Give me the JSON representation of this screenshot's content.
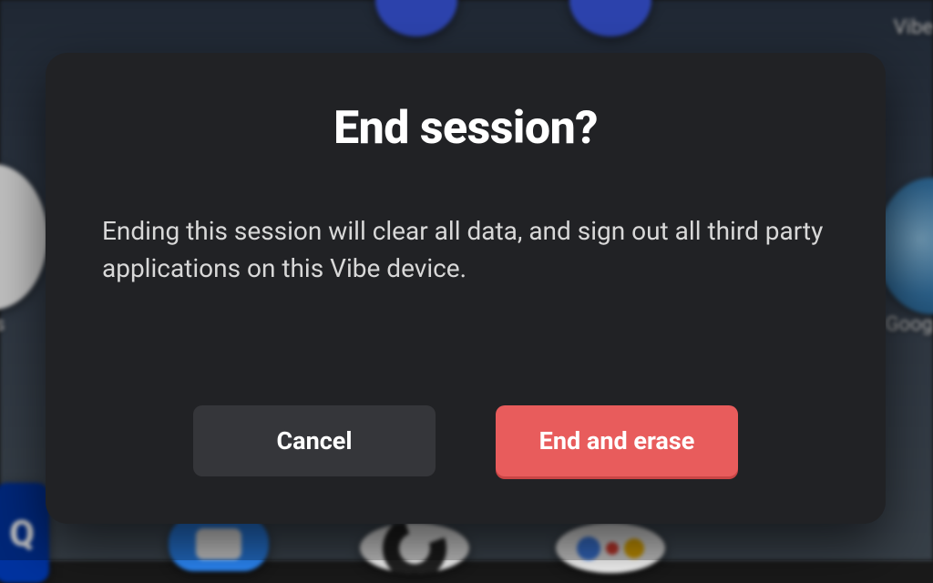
{
  "dialog": {
    "title": "End session?",
    "body": "Ending this session will clear all data, and sign out all third party applications on this Vibe device.",
    "cancel_label": "Cancel",
    "confirm_label": "End and erase"
  },
  "background": {
    "label_left_partial": "s",
    "label_right_top_partial": "Vibe",
    "label_right_mid_partial": "Goog"
  }
}
